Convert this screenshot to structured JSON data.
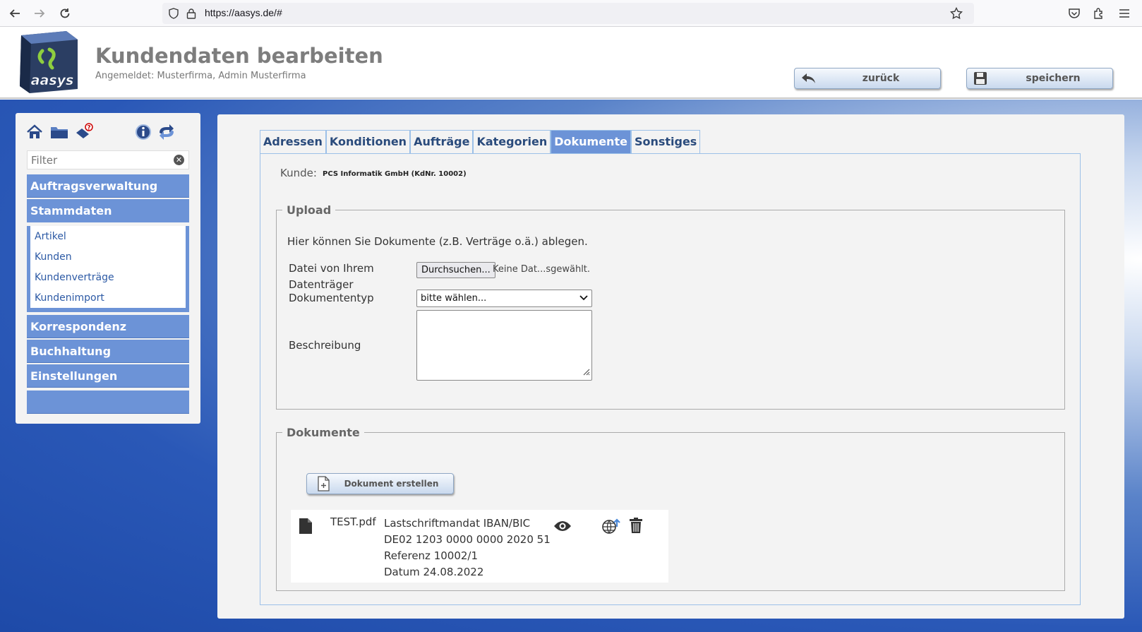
{
  "browser": {
    "url": "https://aasys.de/#"
  },
  "header": {
    "logo_text": "aasys",
    "title": "Kundendaten bearbeiten",
    "login_info": "Angemeldet: Musterfirma, Admin Musterfirma",
    "back_label": "zurück",
    "save_label": "speichern"
  },
  "sidebar": {
    "filter_placeholder": "Filter",
    "menu": [
      {
        "label": "Auftragsverwaltung"
      },
      {
        "label": "Stammdaten"
      },
      {
        "label": "Korrespondenz"
      },
      {
        "label": "Buchhaltung"
      },
      {
        "label": "Einstellungen"
      }
    ],
    "submenu": [
      "Artikel",
      "Kunden",
      "Kundenverträge",
      "Kundenimport"
    ]
  },
  "tabs": [
    "Adressen",
    "Konditionen",
    "Aufträge",
    "Kategorien",
    "Dokumente",
    "Sonstiges"
  ],
  "active_tab": "Dokumente",
  "customer": {
    "label": "Kunde:",
    "value": "PCS Informatik GmbH (KdNr. 10002)"
  },
  "upload": {
    "legend": "Upload",
    "hint": "Hier können Sie Dokumente (z.B. Verträge o.ä.) ablegen.",
    "file_label_1": "Datei von Ihrem",
    "file_label_2": "Datenträger",
    "browse_label": "Durchsuchen...",
    "no_file_text": "Keine Dat...sgewählt.",
    "doctype_label": "Dokumententyp",
    "doctype_value": "bitte wählen...",
    "description_label": "Beschreibung"
  },
  "documents": {
    "legend": "Dokumente",
    "create_label": "Dokument erstellen",
    "rows": [
      {
        "name": "TEST.pdf",
        "description": "Lastschriftmandat IBAN/BIC\nDE02 1203 0000 0000 2020 51\nReferenz 10002/1\nDatum 24.08.2022"
      }
    ]
  }
}
